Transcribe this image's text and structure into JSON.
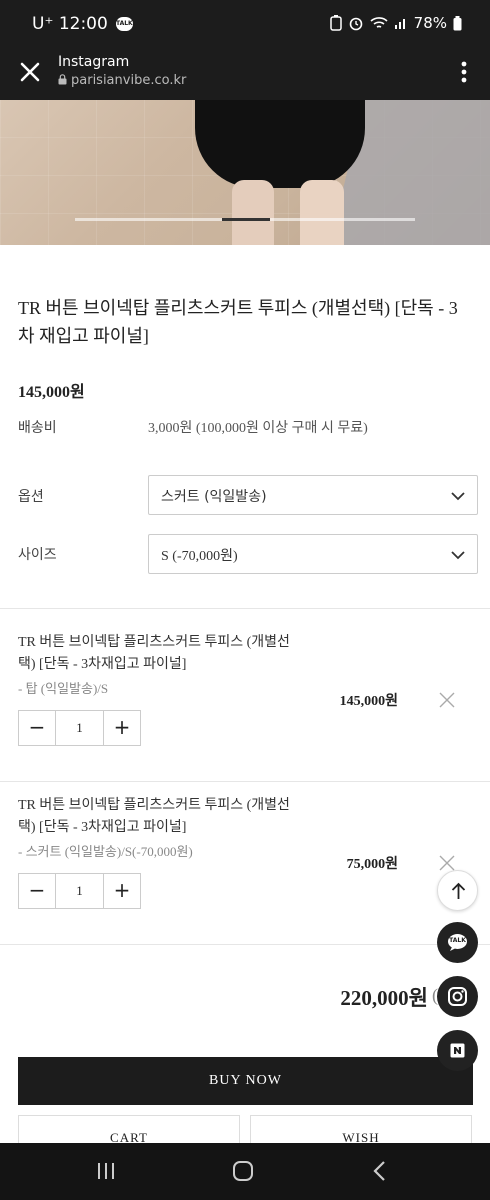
{
  "status_bar": {
    "carrier_time": "U⁺ 12:00",
    "talk_badge": "TALK",
    "battery": "78%"
  },
  "browser_bar": {
    "title": "Instagram",
    "url": "parisianvibe.co.kr"
  },
  "product": {
    "title": "TR 버튼 브이넥탑 플리츠스커트 투피스 (개별선택) [단독 - 3차 재입고 파이널]",
    "price": "145,000원",
    "shipping_label": "배송비",
    "shipping_value": "3,000원 (100,000원 이상 구매 시 무료)",
    "option_label": "옵션",
    "option_value": "스커트 (익일발송)",
    "size_label": "사이즈",
    "size_value": "S (-70,000원)"
  },
  "selected_items": [
    {
      "name": "TR 버튼 브이넥탑 플리츠스커트 투피스 (개별선택) [단독 - 3차재입고 파이널]",
      "option": "- 탑 (익일발송)/S",
      "qty": "1",
      "price": "145,000원"
    },
    {
      "name": "TR 버튼 브이넥탑 플리츠스커트 투피스 (개별선택) [단독 - 3차재입고 파이널]",
      "option": "- 스커트 (익일발송)/S(-70,000원)",
      "qty": "1",
      "price": "75,000원"
    }
  ],
  "qty_controls": {
    "minus": "−",
    "plus": "+"
  },
  "total": {
    "amount": "220,000원",
    "paren": "("
  },
  "buttons": {
    "buy_now": "BUY NOW",
    "cart": "CART",
    "wish": "WISH"
  },
  "floating": {
    "talk_label": "TALK"
  },
  "colors": {
    "dark": "#1c1c1c",
    "border": "#cccccc"
  }
}
